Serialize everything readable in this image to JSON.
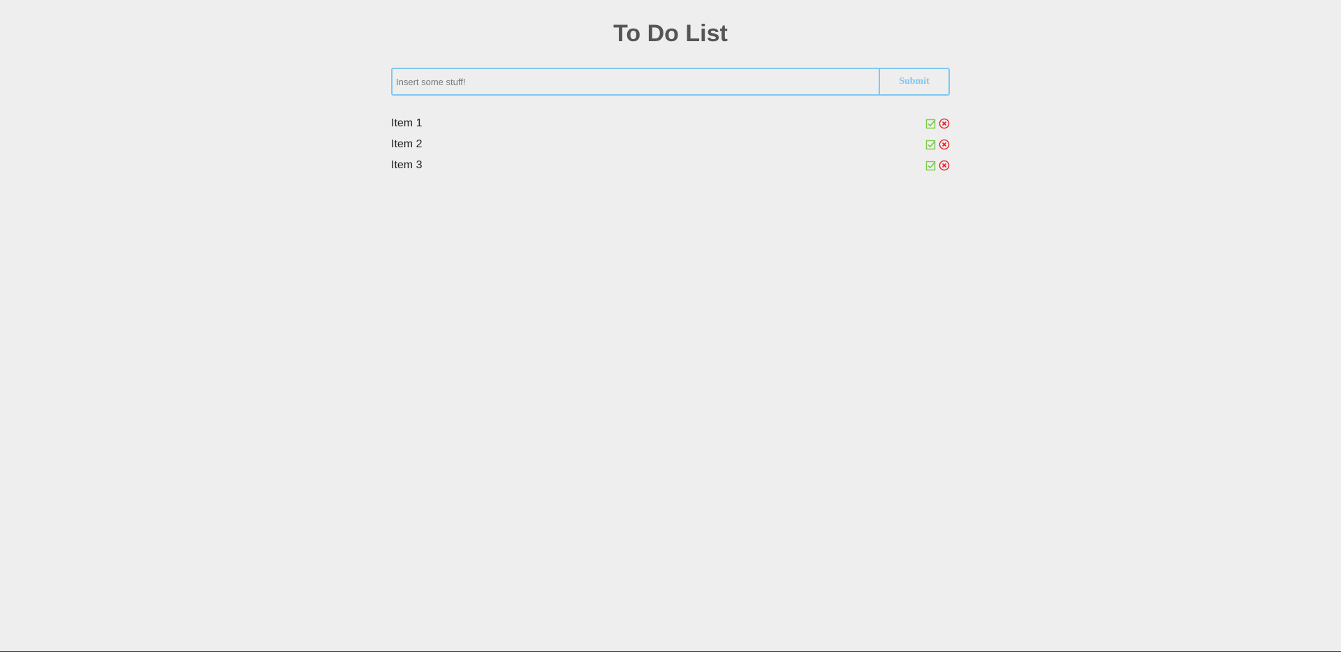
{
  "header": {
    "title": "To Do List"
  },
  "form": {
    "input_value": "",
    "input_placeholder": "Insert some stuff!",
    "submit_label": "Submit"
  },
  "items": [
    {
      "label": "Item 1",
      "complete_icon": "checkbox-check-icon",
      "delete_icon": "circle-x-icon"
    },
    {
      "label": "Item 2",
      "complete_icon": "checkbox-check-icon",
      "delete_icon": "circle-x-icon"
    },
    {
      "label": "Item 3",
      "complete_icon": "checkbox-check-icon",
      "delete_icon": "circle-x-icon"
    }
  ],
  "colors": {
    "background": "#eeeeee",
    "title": "#555555",
    "accent": "#7ec8f0",
    "complete": "#7ac943",
    "delete": "#e0202a",
    "text": "#222222"
  }
}
